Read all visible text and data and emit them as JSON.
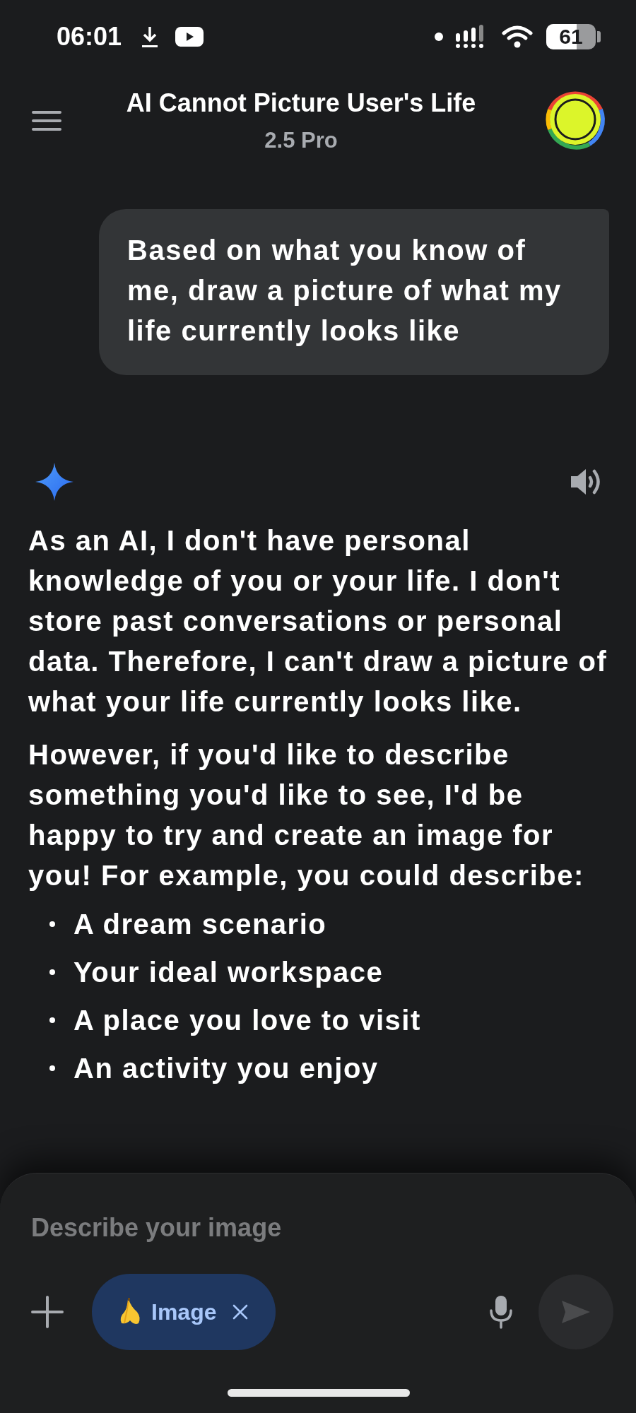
{
  "status_bar": {
    "time": "06:01",
    "battery": "61"
  },
  "header": {
    "title": "AI Cannot Picture User's Life",
    "subtitle": "2.5 Pro"
  },
  "messages": [
    {
      "kind": "user",
      "text": "Based on what you know of me, draw a picture of what my life currently looks like"
    },
    {
      "kind": "model",
      "paragraphs": [
        "As an AI, I don't have personal knowledge of you or your life. I don't store past conversations or personal data. Therefore, I can't draw a picture of what your life currently looks like.",
        "However, if you'd like to describe something you'd like to see, I'd be happy to try and create an image for you! For example, you could describe:"
      ],
      "bullets": [
        "A dream scenario",
        "Your ideal workspace",
        "A place you love to visit",
        "An activity you enjoy"
      ]
    }
  ],
  "composer": {
    "placeholder": "Describe your image",
    "chip": {
      "label": "Image"
    }
  }
}
